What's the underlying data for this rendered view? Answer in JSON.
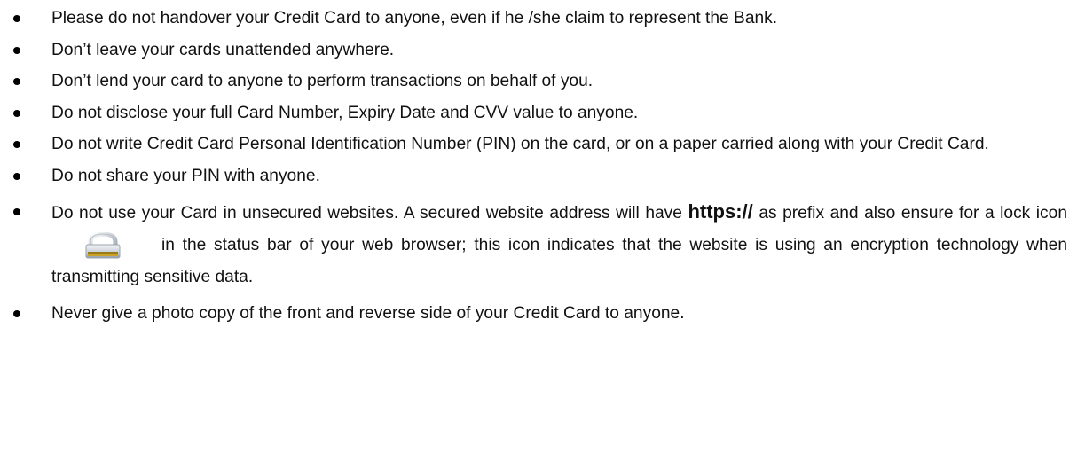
{
  "tips": [
    {
      "text": "Please do not handover your Credit Card to anyone, even if he /she claim to represent the Bank."
    },
    {
      "text": "Don’t leave your cards unattended anywhere."
    },
    {
      "text": "Don’t lend your card to anyone to perform transactions on behalf of you."
    },
    {
      "text": "Do not disclose your full Card Number, Expiry Date and CVV value to anyone."
    },
    {
      "text": "Do not write Credit Card Personal Identification Number (PIN) on the card, or on a paper carried along with your Credit Card."
    },
    {
      "text": "Do not share your PIN with anyone."
    },
    {
      "part1": "Do not use your Card in unsecured websites. A secured website address will have ",
      "bold": "https://",
      "part2": " as prefix and also ensure for a lock icon",
      "part3": "in the status bar of your web browser; this icon indicates that the website is using an encryption technology when transmitting sensitive data.",
      "icon": "lock-icon"
    },
    {
      "text": "Never give a photo copy of the front and reverse side of your Credit Card to anyone."
    }
  ]
}
